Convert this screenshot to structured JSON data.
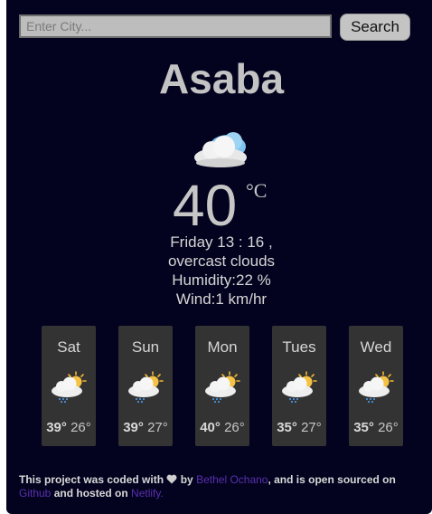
{
  "search": {
    "placeholder": "Enter City...",
    "value": "",
    "button_label": "Search"
  },
  "current": {
    "city": "Asaba",
    "icon": "cloud-icon",
    "temperature": "40",
    "unit": "°C",
    "datetime": "Friday 13 : 16 ,",
    "condition": "overcast clouds",
    "humidity": "Humidity:22 %",
    "wind": "Wind:1 km/hr"
  },
  "forecast": [
    {
      "day": "Sat",
      "icon": "sun-cloud-rain-icon",
      "high": "39°",
      "low": "26°"
    },
    {
      "day": "Sun",
      "icon": "sun-cloud-rain-icon",
      "high": "39°",
      "low": "27°"
    },
    {
      "day": "Mon",
      "icon": "sun-cloud-rain-icon",
      "high": "40°",
      "low": "26°"
    },
    {
      "day": "Tues",
      "icon": "sun-cloud-rain-icon",
      "high": "35°",
      "low": "27°"
    },
    {
      "day": "Wed",
      "icon": "sun-cloud-rain-icon",
      "high": "35°",
      "low": "26°"
    }
  ],
  "footer": {
    "text_1": "This project was coded with",
    "heart_icon": "heart-icon",
    "text_2": "by",
    "author_link": "Bethel Ochano",
    "text_3": ", and is open sourced on",
    "github_link": "Github",
    "text_4": "and hosted on",
    "netlify_link": "Netlify.",
    "heart_color": "#cfcfcf",
    "link_color": "#5a2fb0"
  },
  "colors": {
    "background": "#03031f",
    "panel": "#333333",
    "text": "#c6c6c6"
  }
}
